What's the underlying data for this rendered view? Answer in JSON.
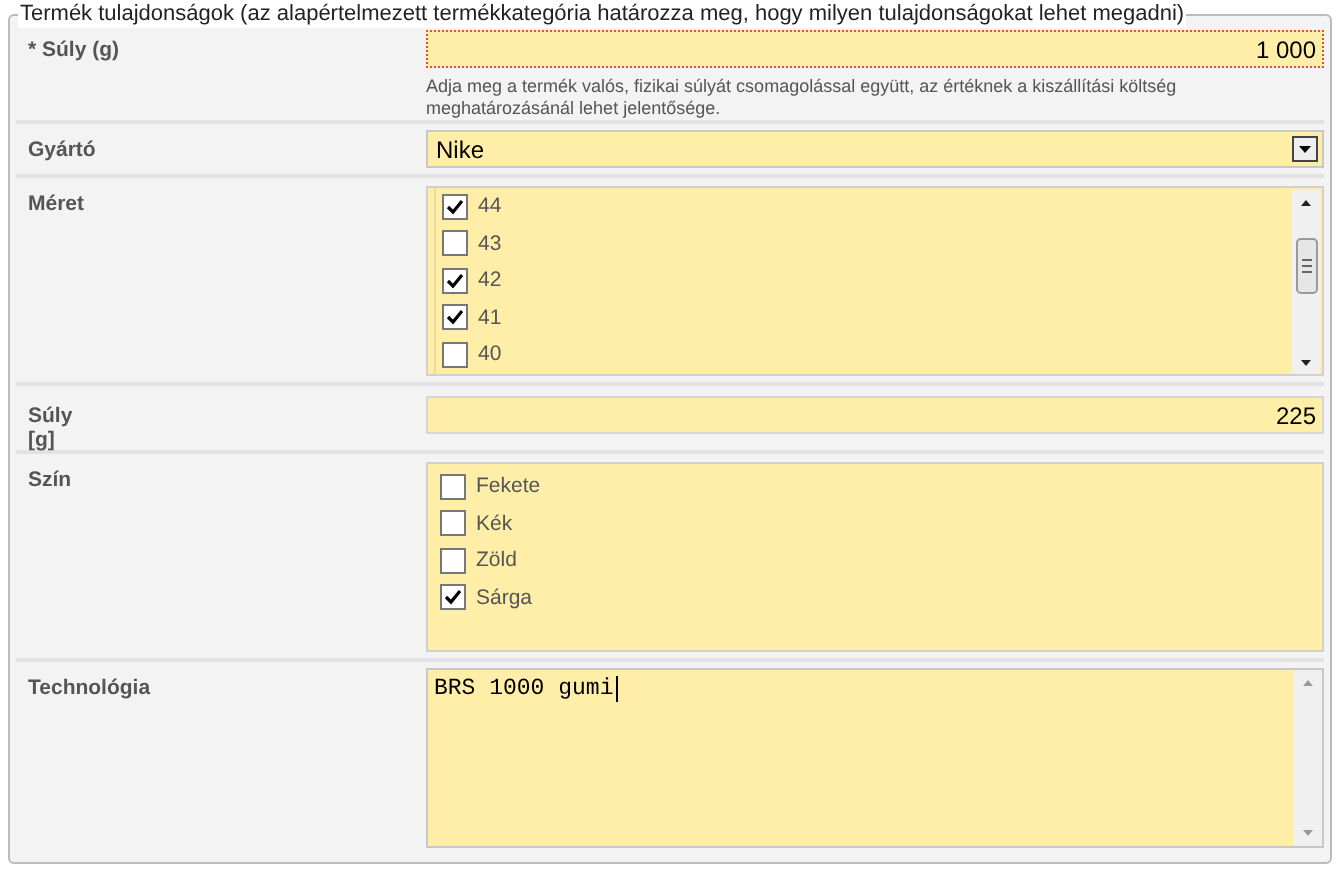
{
  "legend": "Termék tulajdonságok (az alapértelmezett termékkategória határozza meg, hogy milyen tulajdonságokat lehet megadni)",
  "rows": [
    {
      "kind": "text",
      "label": "* Súly (g)",
      "value": "1 000",
      "invalid": true,
      "help": "Adja meg a termék valós, fizikai súlyát csomagolással együtt, az értéknek a kiszállítási költség meghatározásánál lehet jelentősége."
    },
    {
      "kind": "select",
      "label": "Gyártó",
      "value": "Nike"
    },
    {
      "kind": "checklist",
      "label": "Méret",
      "scrollable": true,
      "options": [
        {
          "label": "44",
          "checked": true
        },
        {
          "label": "43",
          "checked": false
        },
        {
          "label": "42",
          "checked": true
        },
        {
          "label": "41",
          "checked": true
        },
        {
          "label": "40",
          "checked": false
        }
      ]
    },
    {
      "kind": "text",
      "label": "Súly\n[g]",
      "value": "225",
      "invalid": false
    },
    {
      "kind": "checklist",
      "label": "Szín",
      "scrollable": false,
      "options": [
        {
          "label": "Fekete",
          "checked": false
        },
        {
          "label": "Kék",
          "checked": false
        },
        {
          "label": "Zöld",
          "checked": false
        },
        {
          "label": "Sárga",
          "checked": true
        }
      ]
    },
    {
      "kind": "textarea",
      "label": "Technológia",
      "value": "BRS 1000 gumi",
      "focused": true
    }
  ]
}
